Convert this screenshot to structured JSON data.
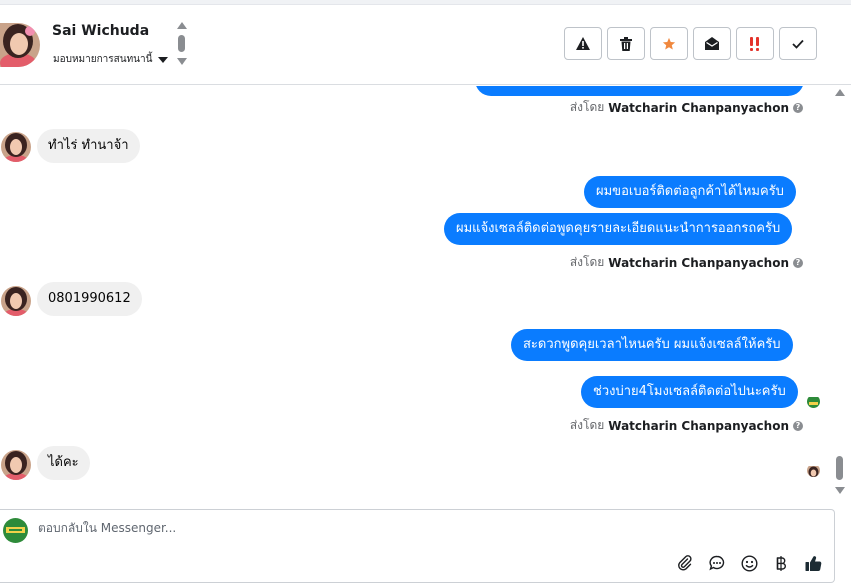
{
  "header": {
    "contact_name": "Sai Wichuda",
    "assign_label": "มอบหมายการสนทนานี้"
  },
  "toolbar": [
    {
      "name": "report-spam-button",
      "icon": "warning-icon"
    },
    {
      "name": "delete-button",
      "icon": "trash-icon"
    },
    {
      "name": "star-button",
      "icon": "star-icon",
      "color": "#f0883e"
    },
    {
      "name": "mark-unread-button",
      "icon": "open-envelope-icon"
    },
    {
      "name": "mark-important-button",
      "icon": "double-exclamation-icon",
      "color": "#e4332b"
    },
    {
      "name": "mark-done-button",
      "icon": "check-icon"
    }
  ],
  "messages": {
    "sent_by_prefix": "ส่งโดย",
    "agent_name": "Watcharin Chanpanyachon",
    "in1": "ทำไร่ ทำนาจ้า",
    "out1": "ผมขอเบอร์ติดต่อลูกค้าได้ไหมครับ",
    "out2": "ผมแจ้งเซลล์ติดต่อพูดคุยรายละเอียดแนะนำการออกรถครับ",
    "in2": "0801990612",
    "out3": "สะดวกพูดคุยเวลาไหนครับ ผมแจ้งเซลล์ให้ครับ",
    "out4": "ช่วงบ่าย4โมงเซลล์ติดต่อไปนะครับ",
    "in3": "ได้คะ"
  },
  "composer": {
    "placeholder": "ตอบกลับใน Messenger..."
  },
  "colors": {
    "outgoing_bubble": "#0a7cff",
    "incoming_bubble": "#f0f0f0",
    "like_icon": "#1c2b33"
  }
}
